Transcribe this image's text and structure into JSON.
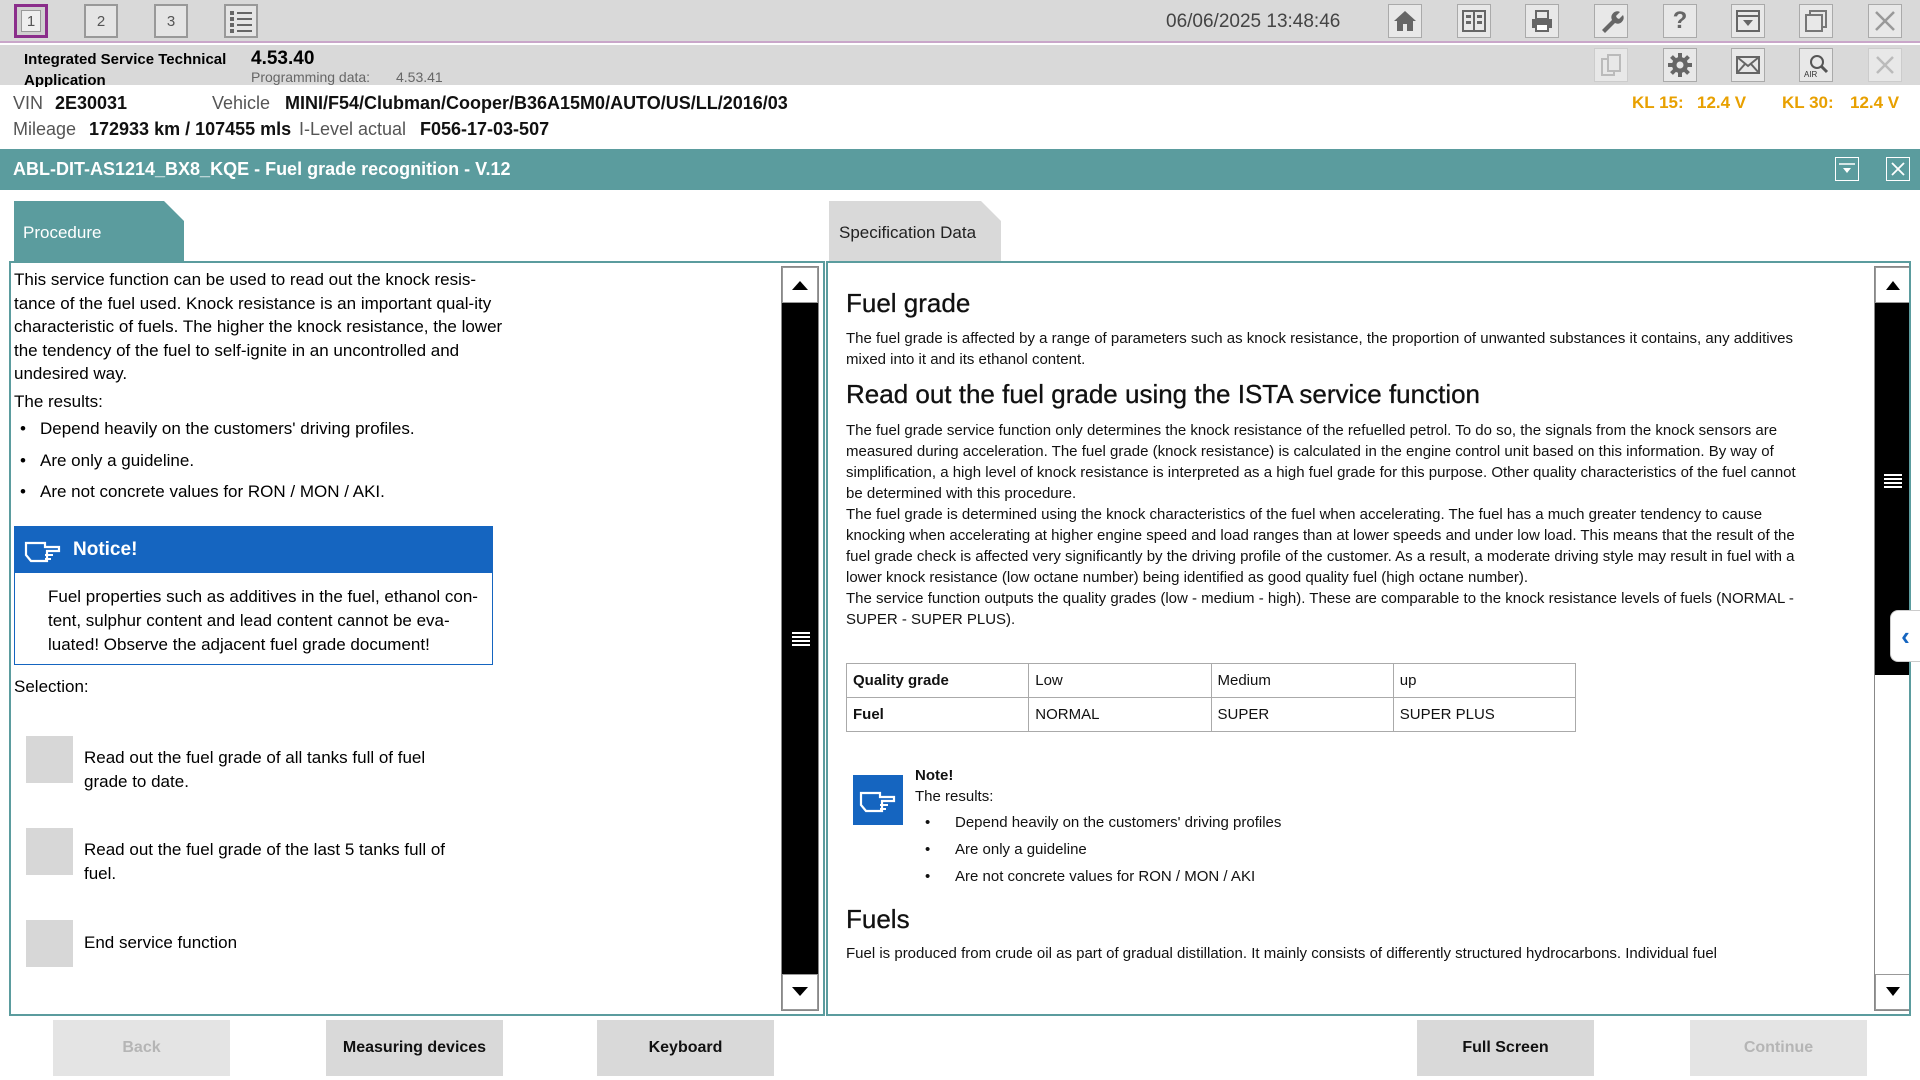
{
  "topbar": {
    "tabs": [
      "1",
      "2",
      "3"
    ],
    "datetime": "06/06/2025 13:48:46"
  },
  "appbar": {
    "title": "Integrated Service Technical Application",
    "version": "4.53.40",
    "programming_label": "Programming data:",
    "programming_value": "4.53.41"
  },
  "vehicle": {
    "vin_label": "VIN",
    "vin": "2E30031",
    "vehicle_label": "Vehicle",
    "vehicle": "MINI/F54/Clubman/Cooper/B36A15M0/AUTO/US/LL/2016/03",
    "mileage_label": "Mileage",
    "mileage": "172933 km / 107455 mls",
    "ilevel_label": "I-Level actual",
    "ilevel": "F056-17-03-507",
    "kl15_label": "KL 15:",
    "kl15": "12.4 V",
    "kl30_label": "KL 30:",
    "kl30": "12.4 V"
  },
  "title": "ABL-DIT-AS1214_BX8_KQE - Fuel grade recognition - V.12",
  "procedure": {
    "tab_label": "Procedure",
    "intro": "This service function can be used to read out the knock resis-tance of the fuel used. Knock resistance is an important qual-ity characteristic of fuels. The higher the knock resistance, the lower the tendency of the fuel to self-ignite in an uncontrolled and undesired way.",
    "results_label": "The results:",
    "results": [
      "Depend heavily on the customers' driving profiles.",
      "Are only a guideline.",
      "Are not concrete values for RON / MON / AKI."
    ],
    "notice_title": "Notice!",
    "notice_body": "Fuel properties such as additives in the fuel, ethanol con-tent, sulphur content and lead content cannot be eva-luated! Observe the adjacent fuel grade document!",
    "selection_label": "Selection:",
    "options": [
      "Read out the fuel grade of all tanks full of fuel grade to date.",
      "Read out the fuel grade of the last 5 tanks full of fuel.",
      "End service function"
    ]
  },
  "spec": {
    "tab_label": "Specification Data",
    "h1": "Fuel grade",
    "p1": "The fuel grade is affected by a range of parameters such as knock resistance, the proportion of unwanted substances it contains, any additives mixed into it and its ethanol content.",
    "h2": "Read out the fuel grade using the ISTA service function",
    "p2": "The fuel grade service function only determines the knock resistance of the refuelled petrol. To do so, the signals from the knock sensors are measured during acceleration. The fuel grade (knock resistance) is calculated in the engine control unit based on this information. By way of simplification, a high level of knock resistance is interpreted as a high fuel grade for this purpose. Other quality characteristics of the fuel cannot be determined with this procedure.",
    "p3": "The fuel grade is determined using the knock characteristics of the fuel when accelerating. The fuel has a much greater tendency to cause knocking when accelerating at higher engine speed and load ranges than at lower speeds and under low load. This means that the result of the fuel grade check is affected very significantly by the driving profile of the customer. As a result, a moderate driving style may result in fuel with a lower knock resistance (low octane number) being identified as good quality fuel (high octane number).",
    "p4": "The service function outputs the quality grades (low - medium - high). These are comparable to the knock resistance levels of fuels (NORMAL - SUPER - SUPER PLUS).",
    "table": {
      "row1": [
        "Quality grade",
        "Low",
        "Medium",
        "up"
      ],
      "row2": [
        "Fuel",
        "NORMAL",
        "SUPER",
        "SUPER PLUS"
      ]
    },
    "note_title": "Note!",
    "note_sub": "The results:",
    "note_items": [
      "Depend heavily on the customers' driving profiles",
      "Are only a guideline",
      "Are not concrete values for RON / MON / AKI"
    ],
    "h3": "Fuels",
    "p5": "Fuel is produced from crude oil as part of gradual distillation. It mainly consists of differently structured hydrocarbons. Individual fuel"
  },
  "buttons": {
    "back": "Back",
    "measuring": "Measuring devices",
    "keyboard": "Keyboard",
    "fullscreen": "Full Screen",
    "continue": "Continue"
  },
  "icons": [
    "home-icon",
    "split-view-icon",
    "printer-icon",
    "wrench-icon",
    "help-icon",
    "dropdown-window-icon",
    "restore-window-icon",
    "close-icon",
    "copy-icon",
    "gear-icon",
    "mail-icon",
    "air-search-icon",
    "notice-hand-icon",
    "list-icon"
  ],
  "colors": {
    "accent": "#5b9c9e",
    "notice": "#1565c0",
    "voltage": "#e8a000",
    "active_tab_border": "#8b2e8b"
  }
}
